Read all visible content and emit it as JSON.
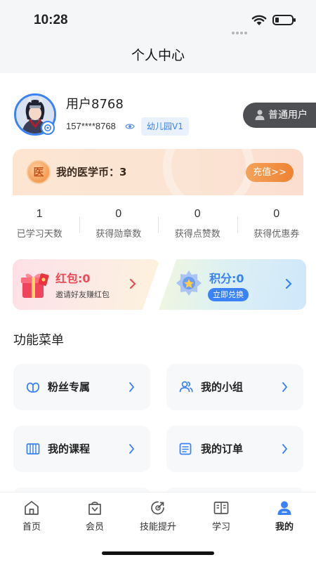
{
  "status": {
    "time": "10:28"
  },
  "nav": {
    "title": "个人中心"
  },
  "profile": {
    "name": "用户8768",
    "phone": "157****8768",
    "level": "幼儿园V1",
    "role": "普通用户"
  },
  "coin": {
    "icon_char": "医",
    "label": "我的医学币：3",
    "recharge": "充值>>"
  },
  "stats": [
    {
      "value": "1",
      "label": "已学习天数"
    },
    {
      "value": "0",
      "label": "获得勋章数"
    },
    {
      "value": "0",
      "label": "获得点赞数"
    },
    {
      "value": "0",
      "label": "获得优惠券"
    }
  ],
  "promos": {
    "red_packet": {
      "title": "红包:0",
      "sub": "邀请好友赚红包"
    },
    "points": {
      "title": "积分:0",
      "button": "立即兑换"
    }
  },
  "menu": {
    "section_title": "功能菜单",
    "items": [
      {
        "label": "粉丝专属",
        "icon": "fans-icon"
      },
      {
        "label": "我的小组",
        "icon": "group-icon"
      },
      {
        "label": "我的课程",
        "icon": "course-icon"
      },
      {
        "label": "我的订单",
        "icon": "order-icon"
      }
    ]
  },
  "tabs": [
    {
      "label": "首页",
      "icon": "home-icon"
    },
    {
      "label": "会员",
      "icon": "member-icon"
    },
    {
      "label": "技能提升",
      "icon": "skill-icon"
    },
    {
      "label": "学习",
      "icon": "book-icon"
    },
    {
      "label": "我的",
      "icon": "profile-icon",
      "active": true
    }
  ],
  "colors": {
    "accent": "#3b82f6",
    "coin": "#ef8232",
    "red_packet": "#ee4b57"
  }
}
